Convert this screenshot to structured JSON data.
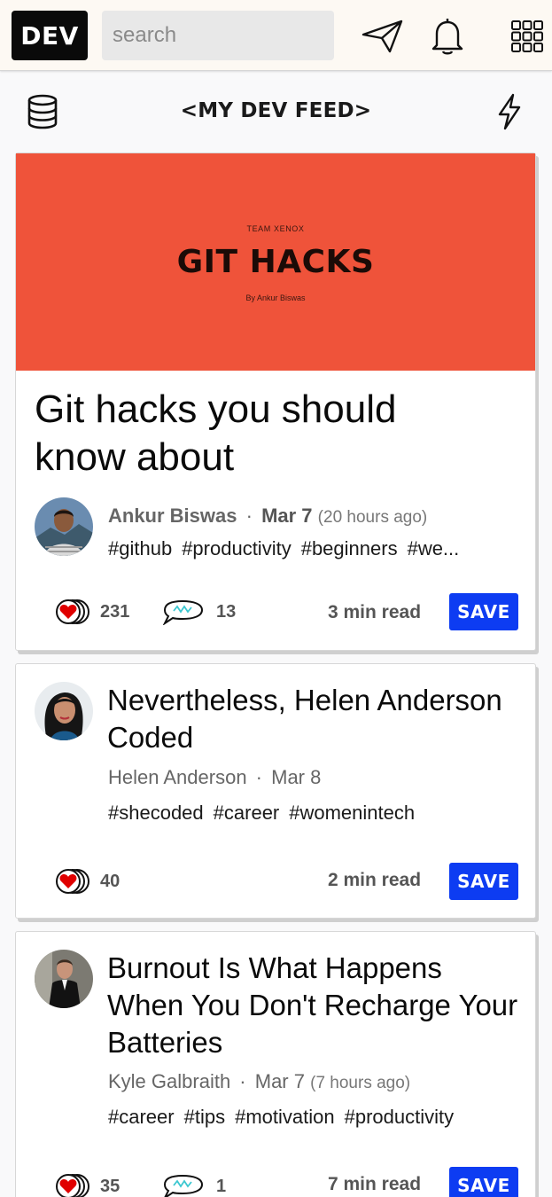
{
  "app": {
    "logo_text": "DEV",
    "search_placeholder": "search"
  },
  "feed": {
    "title": "<MY DEV FEED>"
  },
  "icons": {
    "send": "send-icon",
    "bell": "bell-icon",
    "menu": "apps-grid-icon",
    "database": "database-icon",
    "bolt": "lightning-icon",
    "heart": "heart-icon",
    "comment": "comment-icon"
  },
  "colors": {
    "accent": "#0d3cf2",
    "cover": "#ef533a",
    "heart": "#e00000"
  },
  "cards": [
    {
      "cover": {
        "team": "TEAM XENOX",
        "title": "GIT HACKS",
        "byline": "By Ankur Biswas"
      },
      "title": "Git hacks you should know about",
      "author": "Ankur Biswas",
      "date": "Mar 7",
      "ago": "(20 hours ago)",
      "tags": [
        "#github",
        "#productivity",
        "#beginners",
        "#we..."
      ],
      "reactions": "231",
      "comments": "13",
      "read_time": "3 min read",
      "save_label": "SAVE"
    },
    {
      "title": "Nevertheless, Helen Anderson Coded",
      "author": "Helen Anderson",
      "date": "Mar 8",
      "tags": [
        "#shecoded",
        "#career",
        "#womenintech"
      ],
      "reactions": "40",
      "read_time": "2 min read",
      "save_label": "SAVE"
    },
    {
      "title": "Burnout Is What Happens When You Don't Recharge Your Batteries",
      "author": "Kyle Galbraith",
      "date": "Mar 7",
      "ago": "(7 hours ago)",
      "tags": [
        "#career",
        "#tips",
        "#motivation",
        "#productivity"
      ],
      "reactions": "35",
      "comments": "1",
      "read_time": "7 min read",
      "save_label": "SAVE"
    }
  ]
}
